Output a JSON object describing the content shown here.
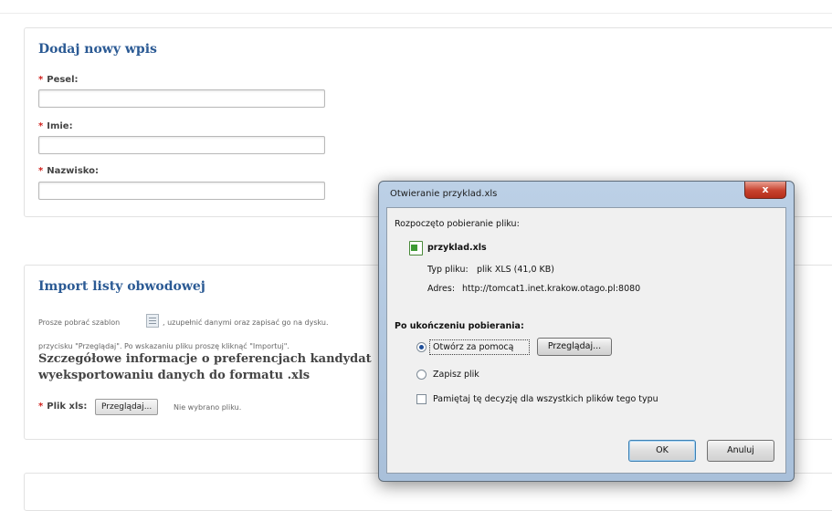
{
  "form": {
    "title": "Dodaj nowy wpis",
    "fields": [
      {
        "label": "Pesel:",
        "value": ""
      },
      {
        "label": "Imie:",
        "value": ""
      },
      {
        "label": "Nazwisko:",
        "value": ""
      }
    ],
    "required_mark": "*"
  },
  "import": {
    "title": "Import listy obwodowej",
    "instructions_line1_a": "Prosze pobrać szablon",
    "instructions_line1_b": ", uzupełnić danymi oraz zapisać go na dysku.",
    "instructions_line2": "przycisku \"Przeglądaj\". Po wskazaniu pliku proszę kliknąć \"Importuj\".",
    "info_line1": "Szczegółowe informacje o preferencjach kandydat",
    "info_line2": "wyeksportowaniu danych do formatu .xls",
    "file_label": "Plik xls:",
    "browse_label": "Przeglądaj...",
    "no_file_text": "Nie wybrano pliku."
  },
  "dialog": {
    "title": "Otwieranie przyklad.xls",
    "close_label": "x",
    "started_text": "Rozpoczęto pobieranie pliku:",
    "file_name": "przyklad.xls",
    "type_label": "Typ pliku:",
    "type_value": "plik XLS (41,0 KB)",
    "address_label": "Adres:",
    "address_value": "http://tomcat1.inet.krakow.otago.pl:8080",
    "after_heading": "Po ukończeniu pobierania:",
    "open_with_label": "Otwórz za pomocą",
    "open_with_browse": "Przeglądaj...",
    "save_label": "Zapisz plik",
    "remember_label": "Pamiętaj tę decyzję dla wszystkich plików tego typu",
    "ok_label": "OK",
    "cancel_label": "Anuluj"
  }
}
